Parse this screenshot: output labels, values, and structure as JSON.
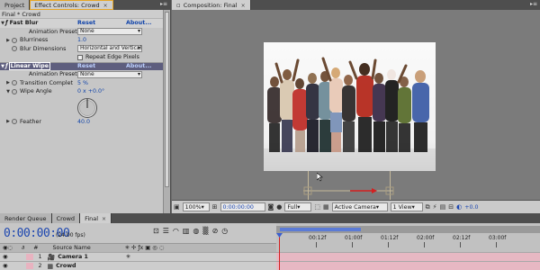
{
  "left_tabs": [
    {
      "label": "Project",
      "active": false
    },
    {
      "label": "Effect Controls: Crowd",
      "active": true
    }
  ],
  "panel_subtitle": "Final * Crowd",
  "fast_blur": {
    "name": "Fast Blur",
    "reset": "Reset",
    "about": "About...",
    "presets_label": "Animation Presets:",
    "presets_value": "None",
    "blurriness_label": "Blurriness",
    "blurriness_value": "1.0",
    "dimensions_label": "Blur Dimensions",
    "dimensions_value": "Horizontal and Vertical",
    "repeat_label": "Repeat Edge Pixels"
  },
  "linear_wipe": {
    "name": "Linear Wipe",
    "reset": "Reset",
    "about": "About...",
    "presets_label": "Animation Presets:",
    "presets_value": "None",
    "completion_label": "Transition Complet",
    "completion_value": "5 %",
    "angle_label": "Wipe Angle",
    "angle_value": "0 x +0.0°",
    "feather_label": "Feather",
    "feather_value": "40.0"
  },
  "comp_tab": "Composition: Final",
  "comp_footer": {
    "zoom": "100%",
    "timecode": "0:00:00:00",
    "resolution": "Full",
    "camera": "Active Camera",
    "views": "1 View",
    "exposure": "+0.0"
  },
  "timeline_tabs": [
    {
      "label": "Render Queue",
      "active": false
    },
    {
      "label": "Crowd",
      "active": false
    },
    {
      "label": "Final",
      "active": true
    }
  ],
  "timeline": {
    "timecode": "0:00:00:00",
    "fps": "(24.00 fps)",
    "col_number": "#",
    "col_source": "Source Name",
    "layers": [
      {
        "index": "1",
        "name": "Camera 1"
      },
      {
        "index": "2",
        "name": "Crowd"
      }
    ],
    "ruler_labels": [
      "00:12f",
      "01:00f",
      "01:12f",
      "02:00f",
      "02:12f",
      "03:00f"
    ]
  },
  "colors": {
    "timecode_blue": "#1c46b0",
    "link_blue": "#1144aa",
    "track_pink": "#e7b8c3",
    "selected_effect": "#5e5e7e"
  }
}
